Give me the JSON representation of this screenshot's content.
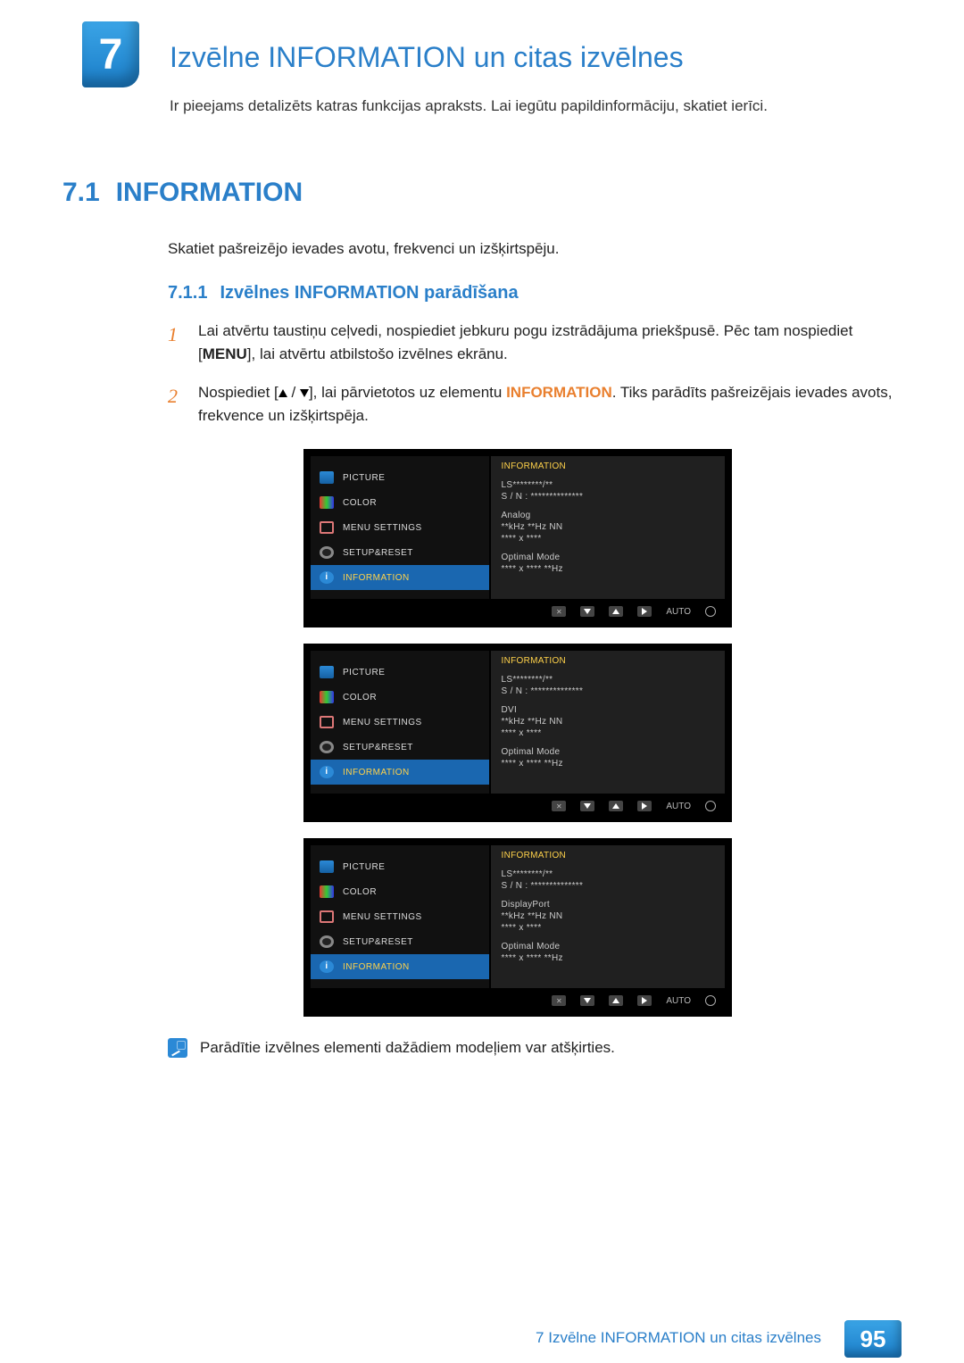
{
  "chapter": {
    "number": "7",
    "title": "Izvēlne INFORMATION un citas izvēlnes",
    "intro": "Ir pieejams detalizēts katras funkcijas apraksts. Lai iegūtu papildinformāciju, skatiet ierīci."
  },
  "section": {
    "number": "7.1",
    "title": "INFORMATION",
    "body": "Skatiet pašreizējo ievades avotu, frekvenci un izšķirtspēju."
  },
  "subsection": {
    "number": "7.1.1",
    "title": "Izvēlnes INFORMATION parādīšana"
  },
  "steps": [
    {
      "n": "1",
      "text_a": "Lai atvērtu taustiņu ceļvedi, nospiediet jebkuru pogu izstrādājuma priekšpusē. Pēc tam nospiediet [",
      "menu_key": "MENU",
      "text_b": "], lai atvērtu atbilstošo izvēlnes ekrānu."
    },
    {
      "n": "2",
      "text_a": "Nospiediet [",
      "arrows": true,
      "text_b": "], lai pārvietotos uz elementu ",
      "kw": "INFORMATION",
      "text_c": ". Tiks parādīts pašreizējais ievades avots, frekvence un izšķirtspēja."
    }
  ],
  "osd": {
    "menu": [
      {
        "label": "PICTURE",
        "icon": "picture"
      },
      {
        "label": "COLOR",
        "icon": "color"
      },
      {
        "label": "MENU SETTINGS",
        "icon": "menu"
      },
      {
        "label": "SETUP&RESET",
        "icon": "setup"
      },
      {
        "label": "INFORMATION",
        "icon": "info",
        "selected": true
      }
    ],
    "panel_title": "INFORMATION",
    "common": {
      "model": "LS********/**",
      "serial": "S / N : **************",
      "freq": "**kHz **Hz NN",
      "res": "**** x ****",
      "opt_label": "Optimal Mode",
      "opt_val": "**** x **** **Hz"
    },
    "variants": [
      {
        "source": "Analog"
      },
      {
        "source": "DVI"
      },
      {
        "source": "DisplayPort"
      }
    ],
    "footer": {
      "auto": "AUTO"
    }
  },
  "note": "Parādītie izvēlnes elementi dažādiem modeļiem var atšķirties.",
  "footer": {
    "title": "7 Izvēlne INFORMATION un citas izvēlnes",
    "page": "95"
  }
}
